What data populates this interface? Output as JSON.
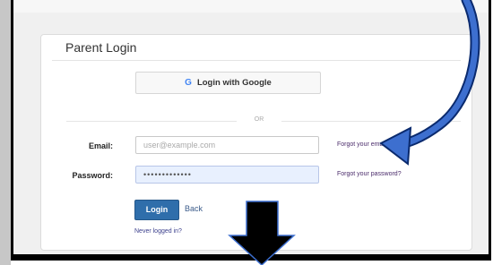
{
  "panel": {
    "title": "Parent Login"
  },
  "google": {
    "icon": "G",
    "label": "Login with Google"
  },
  "divider": {
    "text": "OR"
  },
  "email": {
    "label": "Email:",
    "placeholder": "user@example.com",
    "value": "",
    "forgot": "Forgot your email?"
  },
  "password": {
    "label": "Password:",
    "value": "•••••••••••••",
    "forgot": "Forgot your password?"
  },
  "actions": {
    "login": "Login",
    "back": "Back",
    "never": "Never logged in?"
  },
  "colors": {
    "primary_button": "#2f6eab",
    "arrow_blue": "#3d6fcf",
    "autofill": "#e8f0fe"
  }
}
